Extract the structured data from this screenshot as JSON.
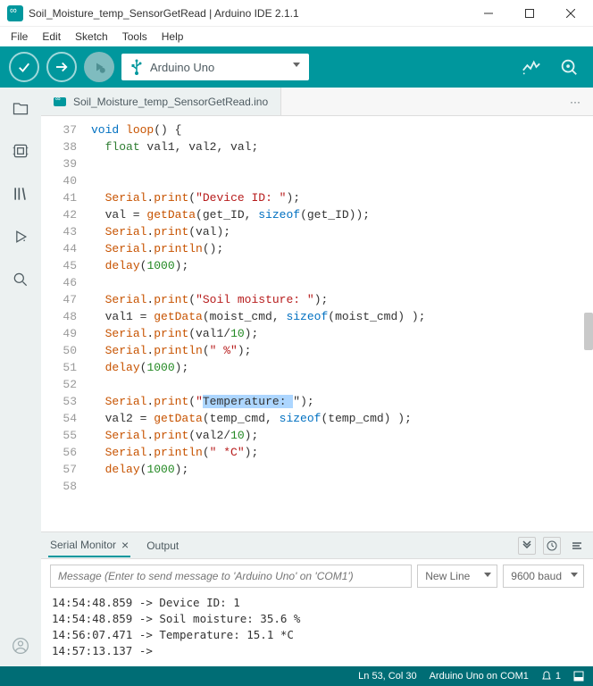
{
  "window": {
    "title": "Soil_Moisture_temp_SensorGetRead | Arduino IDE 2.1.1"
  },
  "menubar": [
    "File",
    "Edit",
    "Sketch",
    "Tools",
    "Help"
  ],
  "board_selector": "Arduino Uno",
  "tab": {
    "name": "Soil_Moisture_temp_SensorGetRead.ino"
  },
  "code_lines": [
    {
      "n": 37,
      "t": "kw:void fn:loop() {"
    },
    {
      "n": 38,
      "t": "  ty:float val1, val2, val;"
    },
    {
      "n": 39,
      "t": ""
    },
    {
      "n": 40,
      "t": ""
    },
    {
      "n": 41,
      "t": "  fn:Serial.fn:print(str:\"Device ID: \");"
    },
    {
      "n": 42,
      "t": "  val = fn:getData(get_ID, kw:sizeof(get_ID));"
    },
    {
      "n": 43,
      "t": "  fn:Serial.fn:print(val);"
    },
    {
      "n": 44,
      "t": "  fn:Serial.fn:println();"
    },
    {
      "n": 45,
      "t": "  fn:delay(num:1000);"
    },
    {
      "n": 46,
      "t": ""
    },
    {
      "n": 47,
      "t": "  fn:Serial.fn:print(str:\"Soil moisture: \");"
    },
    {
      "n": 48,
      "t": "  val1 = fn:getData(moist_cmd, kw:sizeof(moist_cmd) );"
    },
    {
      "n": 49,
      "t": "  fn:Serial.fn:print(val1/num:10);"
    },
    {
      "n": 50,
      "t": "  fn:Serial.fn:println(str:\" %\");"
    },
    {
      "n": 51,
      "t": "  fn:delay(num:1000);"
    },
    {
      "n": 52,
      "t": ""
    },
    {
      "n": 53,
      "t": "  fn:Serial.fn:print(str:\"sel:Temperature: \");"
    },
    {
      "n": 54,
      "t": "  val2 = fn:getData(temp_cmd, kw:sizeof(temp_cmd) );"
    },
    {
      "n": 55,
      "t": "  fn:Serial.fn:print(val2/num:10);"
    },
    {
      "n": 56,
      "t": "  fn:Serial.fn:println(str:\" *C\");"
    },
    {
      "n": 57,
      "t": "  fn:delay(num:1000);"
    },
    {
      "n": 58,
      "t": ""
    }
  ],
  "bottom_panel": {
    "tab1": "Serial Monitor",
    "tab2": "Output",
    "msg_placeholder": "Message (Enter to send message to 'Arduino Uno' on 'COM1')",
    "line_ending": "New Line",
    "baud": "9600 baud",
    "output": [
      "14:54:48.859 -> Device ID: 1",
      "14:54:48.859 -> Soil moisture: 35.6 %",
      "14:56:07.471 -> Temperature: 15.1 *C",
      "14:57:13.137 -> "
    ]
  },
  "status": {
    "pos": "Ln 53, Col 30",
    "board": "Arduino Uno on COM1",
    "notif_count": "1"
  }
}
